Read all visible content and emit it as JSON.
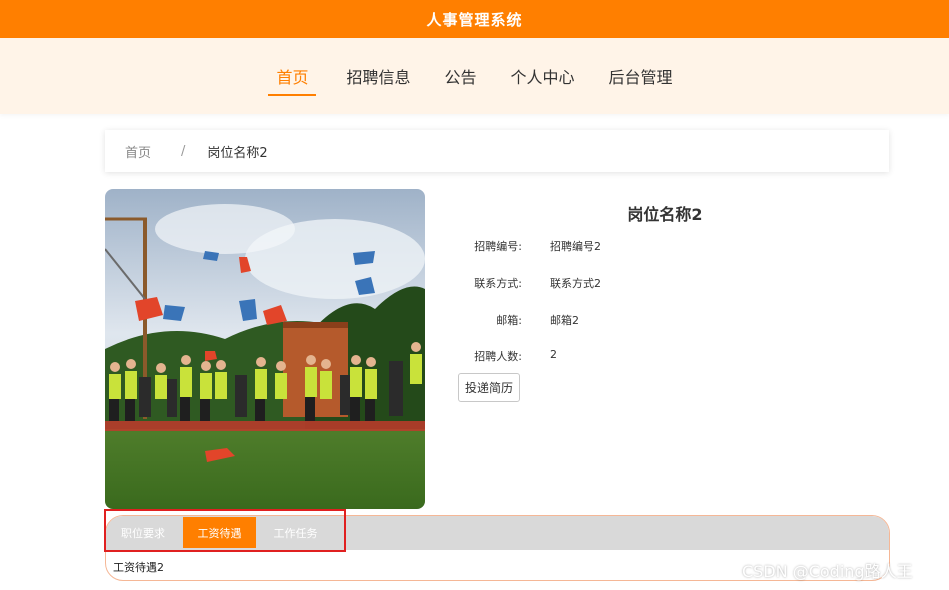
{
  "header": {
    "title": "人事管理系统",
    "brand_color": "#ff7f00"
  },
  "nav": {
    "items": [
      {
        "label": "首页",
        "active": true
      },
      {
        "label": "招聘信息",
        "active": false
      },
      {
        "label": "公告",
        "active": false
      },
      {
        "label": "个人中心",
        "active": false
      },
      {
        "label": "后台管理",
        "active": false
      }
    ]
  },
  "breadcrumb": {
    "home": "首页",
    "separator": "/",
    "current": "岗位名称2"
  },
  "job": {
    "title": "岗位名称2",
    "fields": [
      {
        "label": "招聘编号:",
        "value": "招聘编号2"
      },
      {
        "label": "联系方式:",
        "value": "联系方式2"
      },
      {
        "label": "邮箱:",
        "value": "邮箱2"
      },
      {
        "label": "招聘人数:",
        "value": "2"
      }
    ],
    "apply_label": "投递简历"
  },
  "tabs": {
    "items": [
      {
        "label": "职位要求",
        "active": false
      },
      {
        "label": "工资待遇",
        "active": true
      },
      {
        "label": "工作任务",
        "active": false
      }
    ],
    "content": "工资待遇2"
  },
  "watermark": "CSDN @Coding路人王"
}
